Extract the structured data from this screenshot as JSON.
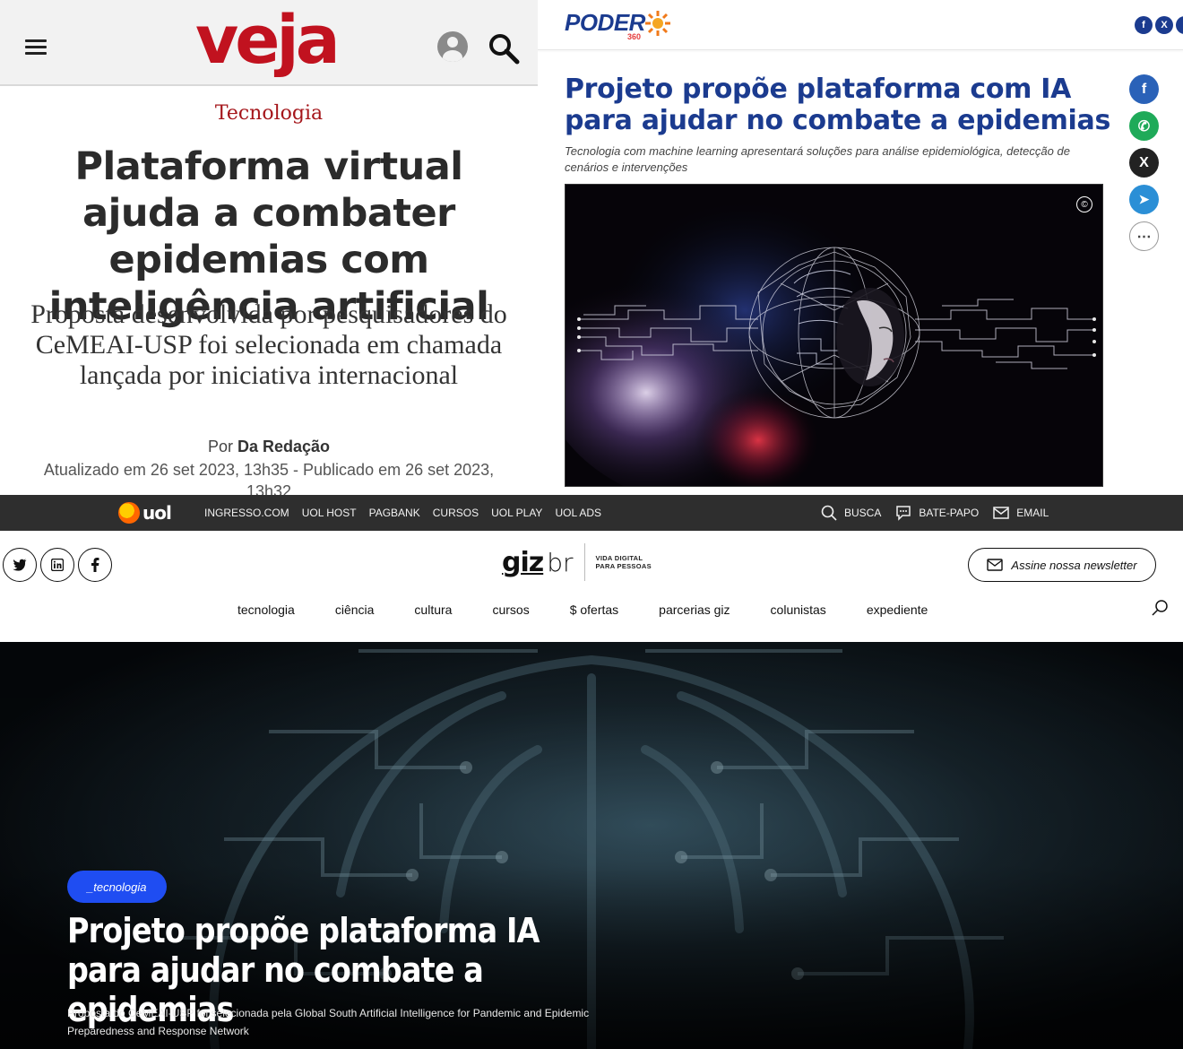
{
  "veja": {
    "logo": "veja",
    "category": "Tecnologia",
    "title": "Plataforma virtual ajuda a combater epidemias com inteligência artificial",
    "subtitle": "Proposta desenvolvida por pesquisadores do CeMEAI-USP foi selecionada em chamada lançada por iniciativa internacional",
    "byline_prefix": "Por",
    "byline_author": "Da Redação",
    "dateline": "Atualizado em 26 set 2023, 13h35 - Publicado em 26 set 2023, 13h32",
    "icons": [
      "menu-icon",
      "user-icon",
      "search-icon"
    ]
  },
  "poder": {
    "logo": "PODER",
    "logo_suffix": "360",
    "title": "Projeto propõe plataforma com IA para ajudar no combate a epidemias",
    "subtitle": "Tecnologia com machine learning apresentará soluções para análise epidemiológica, detecção de cenários e intervenções",
    "copyright_mark": "©",
    "top_social": [
      "f",
      "X",
      ""
    ],
    "side_social": [
      {
        "icon": "facebook-icon",
        "glyph": "f",
        "color": "#2a62b8"
      },
      {
        "icon": "whatsapp-icon",
        "glyph": "✆",
        "color": "#1faa59"
      },
      {
        "icon": "x-icon",
        "glyph": "X",
        "color": "#222222"
      },
      {
        "icon": "telegram-icon",
        "glyph": "➤",
        "color": "#2b8fd6"
      },
      {
        "icon": "more-icon",
        "glyph": "⋯",
        "color": "#ffffff"
      }
    ]
  },
  "uol": {
    "logo": "uol",
    "links": [
      "INGRESSO.COM",
      "UOL HOST",
      "PAGBANK",
      "CURSOS",
      "UOL PLAY",
      "UOL ADS"
    ],
    "busca": "BUSCA",
    "bate_papo": "BATE-PAPO",
    "email": "EMAIL"
  },
  "giz": {
    "logo_main": "giz",
    "logo_br": "br",
    "logo_tag_1": "VIDA DIGITAL",
    "logo_tag_2": "PARA PESSOAS",
    "newsletter": "Assine nossa newsletter",
    "social": [
      "twitter-icon",
      "linkedin-icon",
      "facebook-icon"
    ],
    "nav": [
      "tecnologia",
      "ciência",
      "cultura",
      "cursos",
      "$ ofertas",
      "parcerias giz",
      "colunistas",
      "expediente"
    ],
    "tag": "_tecnologia",
    "title": "Projeto propõe plataforma IA para ajudar no combate a epidemias",
    "subtitle": "Proposta do CeMEAI-USP foi selecionada pela Global South Artificial Intelligence for Pandemic and Epidemic Preparedness and Response Network"
  },
  "colors": {
    "veja_red": "#c1121f",
    "poder_blue": "#1b3b8f",
    "uol_bar": "#2e2e2e",
    "giz_pill": "#1f4df2"
  }
}
